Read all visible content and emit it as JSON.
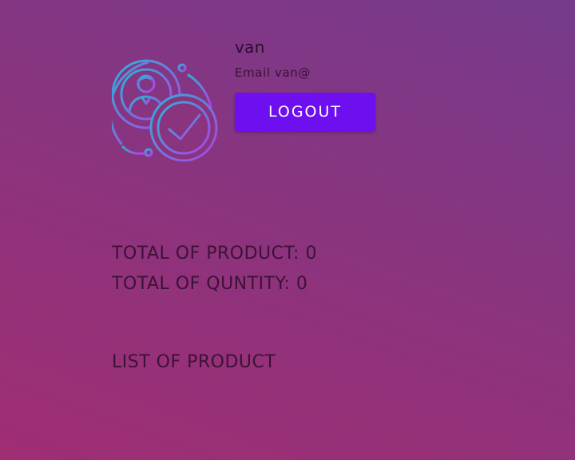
{
  "profile": {
    "avatar_icon": "user-verified-icon",
    "name": "van",
    "email": "Email van@",
    "logout_label": "LOGOUT"
  },
  "stats": {
    "products_label": "TOTAL OF PRODUCT: 0",
    "quantity_label": "TOTAL OF QUNTITY: 0"
  },
  "list": {
    "title": "LIST OF PRODUCT"
  },
  "colors": {
    "logout_button": "#6e0ff0",
    "icon_gradient_start": "#27b6d6",
    "icon_gradient_end": "#b13ee6"
  }
}
